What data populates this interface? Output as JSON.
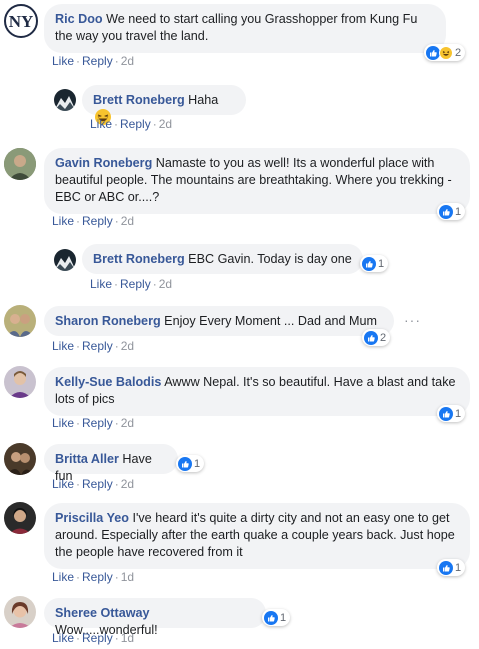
{
  "comments": [
    {
      "author": "Ric Doo",
      "text": "We need to start calling you Grasshopper from Kung Fu the way you travel the land.",
      "like": "Like",
      "reply": "Reply",
      "time": "2d",
      "reactions": "2"
    },
    {
      "author": "Brett Roneberg",
      "text": "Haha",
      "like": "Like",
      "reply": "Reply",
      "time": "2d"
    },
    {
      "author": "Gavin Roneberg",
      "text": "Namaste to you as well! Its a wonderful place with beautiful people. The mountains are breathtaking. Where you trekking - EBC or ABC or....?",
      "like": "Like",
      "reply": "Reply",
      "time": "2d",
      "reactions": "1"
    },
    {
      "author": "Brett Roneberg",
      "text": "EBC Gavin. Today is day one",
      "like": "Like",
      "reply": "Reply",
      "time": "2d",
      "reactions": "1"
    },
    {
      "author": "Sharon Roneberg",
      "text": "Enjoy Every Moment ... Dad and Mum",
      "like": "Like",
      "reply": "Reply",
      "time": "2d",
      "reactions": "2"
    },
    {
      "author": "Kelly-Sue Balodis",
      "text": "Awww Nepal. It's so beautiful. Have a blast and take lots of pics",
      "like": "Like",
      "reply": "Reply",
      "time": "2d",
      "reactions": "1"
    },
    {
      "author": "Britta Aller",
      "text": "Have fun",
      "like": "Like",
      "reply": "Reply",
      "time": "2d",
      "reactions": "1"
    },
    {
      "author": "Priscilla Yeo",
      "text": "I've heard it's quite a dirty city and not an easy one to get around. Especially after the earth quake a couple years back. Just hope the people have recovered from it",
      "like": "Like",
      "reply": "Reply",
      "time": "1d",
      "reactions": "1"
    },
    {
      "author": "Sheree Ottaway",
      "text": "Wow.....wonderful!",
      "like": "Like",
      "reply": "Reply",
      "time": "1d",
      "reactions": "1"
    }
  ],
  "more_icon": "···",
  "colors": {
    "link": "#385898",
    "bubble": "#f2f3f5",
    "like_blue": "#1877f2",
    "meta": "#90949c"
  }
}
